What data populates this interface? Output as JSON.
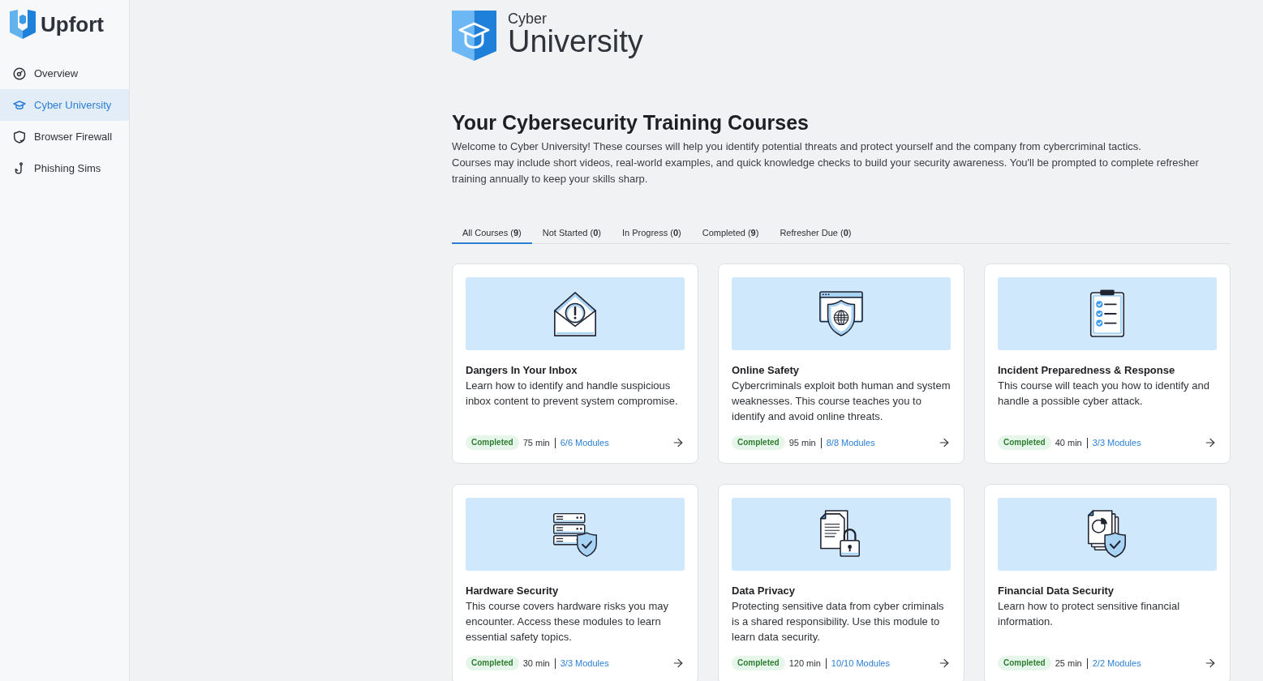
{
  "sidebar": {
    "brand": "Upfort",
    "items": [
      {
        "label": "Overview",
        "selected": false
      },
      {
        "label": "Cyber University",
        "selected": true
      },
      {
        "label": "Browser Firewall",
        "selected": false
      },
      {
        "label": "Phishing Sims",
        "selected": false
      }
    ]
  },
  "header": {
    "logo_top": "Cyber",
    "logo_bottom": "University"
  },
  "title": "Your Cybersecurity Training Courses",
  "intro": [
    "Welcome to Cyber University! These courses will help you identify potential threats and protect yourself and the company from cybercriminal tactics.",
    "Courses may include short videos, real-world examples, and quick knowledge checks to build your security awareness. You'll be prompted to complete refresher training annually to keep your skills sharp."
  ],
  "tabs": [
    {
      "label": "All Courses (**9**)",
      "selected": true
    },
    {
      "label": "Not Started (**0**)",
      "selected": false
    },
    {
      "label": "In Progress (**0**)",
      "selected": false
    },
    {
      "label": "Completed (**9**)",
      "selected": false
    },
    {
      "label": "Refresher Due (**0**)",
      "selected": false
    }
  ],
  "courses": [
    {
      "title": "Dangers In Your Inbox",
      "description": "Learn how to identify and handle suspicious inbox content to prevent system compromise.",
      "status": "Completed",
      "duration": "75 min",
      "modules": "6/6 Modules"
    },
    {
      "title": "Online Safety",
      "description": "Cybercriminals exploit both human and system weaknesses. This course teaches you to identify and avoid online threats.",
      "status": "Completed",
      "duration": "95 min",
      "modules": "8/8 Modules"
    },
    {
      "title": "Incident Preparedness & Response",
      "description": "This course will teach you how to identify and handle a possible cyber attack.",
      "status": "Completed",
      "duration": "40 min",
      "modules": "3/3 Modules"
    },
    {
      "title": "Hardware Security",
      "description": "This course covers hardware risks you may encounter. Access these modules to learn essential safety topics.",
      "status": "Completed",
      "duration": "30 min",
      "modules": "3/3 Modules"
    },
    {
      "title": "Data Privacy",
      "description": "Protecting sensitive data from cyber criminals is a shared responsibility. Use this module to learn data security.",
      "status": "Completed",
      "duration": "120 min",
      "modules": "10/10 Modules"
    },
    {
      "title": "Financial Data Security",
      "description": "Learn how to protect sensitive financial information.",
      "status": "Completed",
      "duration": "25 min",
      "modules": "2/2 Modules"
    }
  ]
}
